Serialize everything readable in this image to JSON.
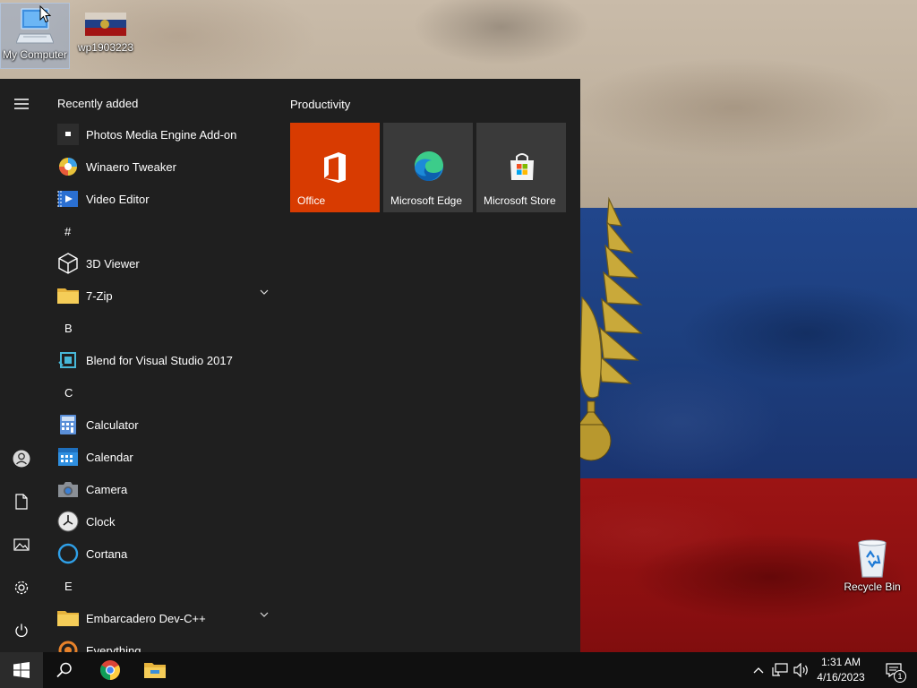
{
  "desktop": {
    "icons": [
      {
        "label": "My Computer"
      },
      {
        "label": "wp1903223"
      },
      {
        "label": "Recycle Bin"
      }
    ]
  },
  "start_menu": {
    "rail": {
      "icons": [
        "hamburger-icon",
        "user-icon",
        "document-icon",
        "pictures-icon",
        "settings-icon",
        "power-icon"
      ]
    },
    "recently_added_header": "Recently added",
    "recent_items": [
      {
        "label": "Photos Media Engine Add-on",
        "icon": "photos-addon-icon"
      },
      {
        "label": "Winaero Tweaker",
        "icon": "winaero-icon"
      },
      {
        "label": "Video Editor",
        "icon": "video-editor-icon"
      }
    ],
    "sections": [
      {
        "letter": "#",
        "items": [
          {
            "label": "3D Viewer",
            "icon": "cube-icon",
            "expandable": false
          },
          {
            "label": "7-Zip",
            "icon": "folder-icon",
            "expandable": true
          }
        ]
      },
      {
        "letter": "B",
        "items": [
          {
            "label": "Blend for Visual Studio 2017",
            "icon": "blend-icon",
            "expandable": false
          }
        ]
      },
      {
        "letter": "C",
        "items": [
          {
            "label": "Calculator",
            "icon": "calculator-icon",
            "expandable": false
          },
          {
            "label": "Calendar",
            "icon": "calendar-icon",
            "expandable": false
          },
          {
            "label": "Camera",
            "icon": "camera-icon",
            "expandable": false
          },
          {
            "label": "Clock",
            "icon": "clock-icon",
            "expandable": false
          },
          {
            "label": "Cortana",
            "icon": "cortana-icon",
            "expandable": false
          }
        ]
      },
      {
        "letter": "E",
        "items": [
          {
            "label": "Embarcadero Dev-C++",
            "icon": "folder-icon",
            "expandable": true
          },
          {
            "label": "Everything",
            "icon": "everything-icon",
            "expandable": false
          }
        ]
      }
    ],
    "tile_group": {
      "title": "Productivity",
      "tiles": [
        {
          "label": "Office",
          "icon": "office-icon",
          "color": "#d83b01"
        },
        {
          "label": "Microsoft Edge",
          "icon": "edge-icon",
          "color": "#3a3a3a"
        },
        {
          "label": "Microsoft Store",
          "icon": "store-icon",
          "color": "#3a3a3a"
        }
      ]
    }
  },
  "taskbar": {
    "pinned": [
      "windows-start-icon",
      "search-icon",
      "chrome-icon",
      "file-explorer-icon"
    ],
    "tray_icons": [
      "chevron-up-icon",
      "network-icon",
      "volume-icon"
    ],
    "time": "1:31 AM",
    "date": "4/16/2023",
    "notification_count": "1"
  }
}
